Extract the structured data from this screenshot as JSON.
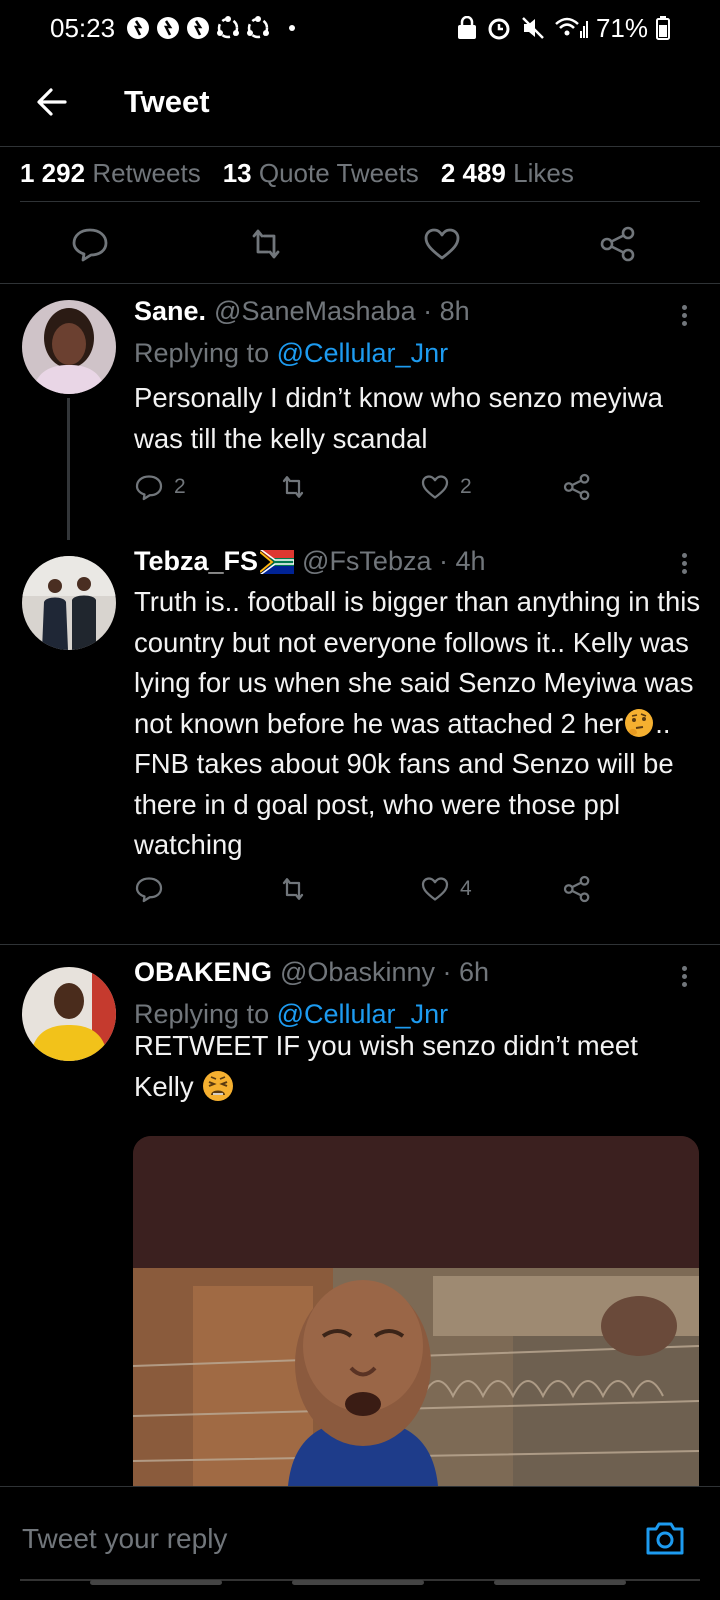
{
  "status": {
    "time": "05:23",
    "battery": "71%"
  },
  "header": {
    "title": "Tweet"
  },
  "stats": [
    {
      "count": "1 292",
      "label": "Retweets"
    },
    {
      "count": "13",
      "label": "Quote Tweets"
    },
    {
      "count": "2 489",
      "label": "Likes"
    }
  ],
  "replies": [
    {
      "name": "Sane.",
      "handle": "@SaneMashaba · 8h",
      "replying_prefix": "Replying to",
      "replying_to": "@Cellular_Jnr",
      "text": "Personally I didn’t know who senzo meyiwa was till the kelly scandal",
      "reply_count": "2",
      "like_count": "2"
    },
    {
      "name": "Tebza_FS",
      "handle": "@FsTebza · 4h",
      "text_1": "Truth is.. football is bigger than anything in this country but not everyone follows it.. Kelly was lying for us when she said Senzo Meyiwa was not known before he was attached 2 her",
      "text_2": ".. FNB takes about 90k fans and Senzo will be there in d goal post, who were those ppl watching",
      "like_count": "4"
    },
    {
      "name": "OBAKENG",
      "handle": "@Obaskinny · 6h",
      "replying_prefix": "Replying to",
      "replying_to": "@Cellular_Jnr",
      "text": "RETWEET IF you wish senzo didn’t meet Kelly"
    }
  ],
  "compose": {
    "placeholder": "Tweet your reply"
  },
  "colors": {
    "accent": "#1d9bf0",
    "muted": "#71767b",
    "background": "#000000"
  }
}
